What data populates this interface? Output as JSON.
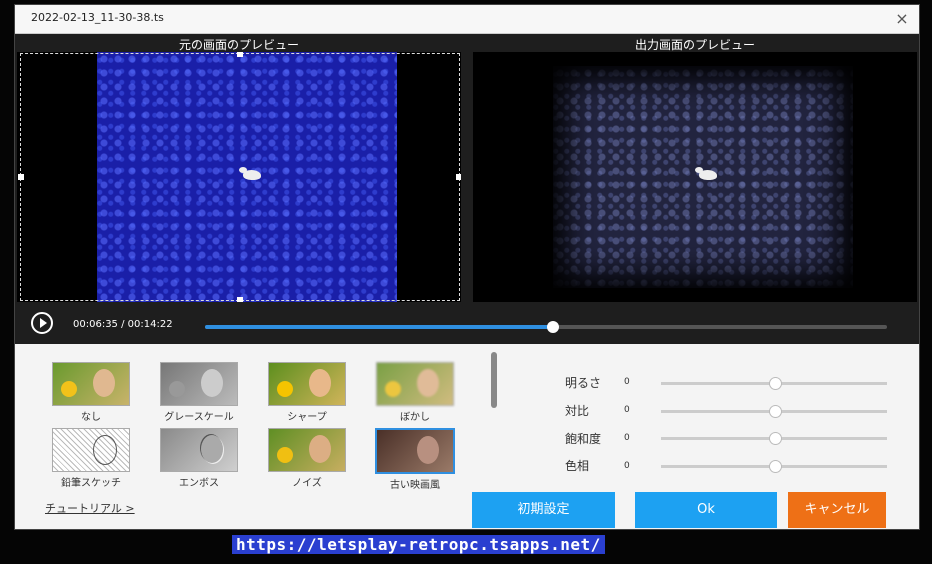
{
  "window": {
    "title": "2022-02-13_11-30-38.ts",
    "close_icon": "×"
  },
  "preview": {
    "original_title": "元の画面のプレビュー",
    "output_title": "出力画面のプレビュー"
  },
  "playback": {
    "current": "00:06:35",
    "separator": "/",
    "total": "00:14:22",
    "progress": 0.51
  },
  "filters": [
    {
      "label": "なし"
    },
    {
      "label": "グレースケール"
    },
    {
      "label": "シャープ"
    },
    {
      "label": "ぼかし"
    },
    {
      "label": "鉛筆スケッチ"
    },
    {
      "label": "エンボス"
    },
    {
      "label": "ノイズ"
    },
    {
      "label": "古い映画風",
      "selected": true
    }
  ],
  "adjustments": [
    {
      "label": "明るさ",
      "value": "0"
    },
    {
      "label": "対比",
      "value": "0"
    },
    {
      "label": "飽和度",
      "value": "0"
    },
    {
      "label": "色相",
      "value": "0"
    }
  ],
  "footer": {
    "tutorial": "チュートリアル >",
    "reset": "初期設定",
    "ok": "Ok",
    "cancel": "キャンセル"
  },
  "watermark": "https://letsplay-retropc.tsapps.net/",
  "colors": {
    "accent": "#1da1f2",
    "cancel": "#ee7016",
    "progress": "#2f8fe0"
  }
}
